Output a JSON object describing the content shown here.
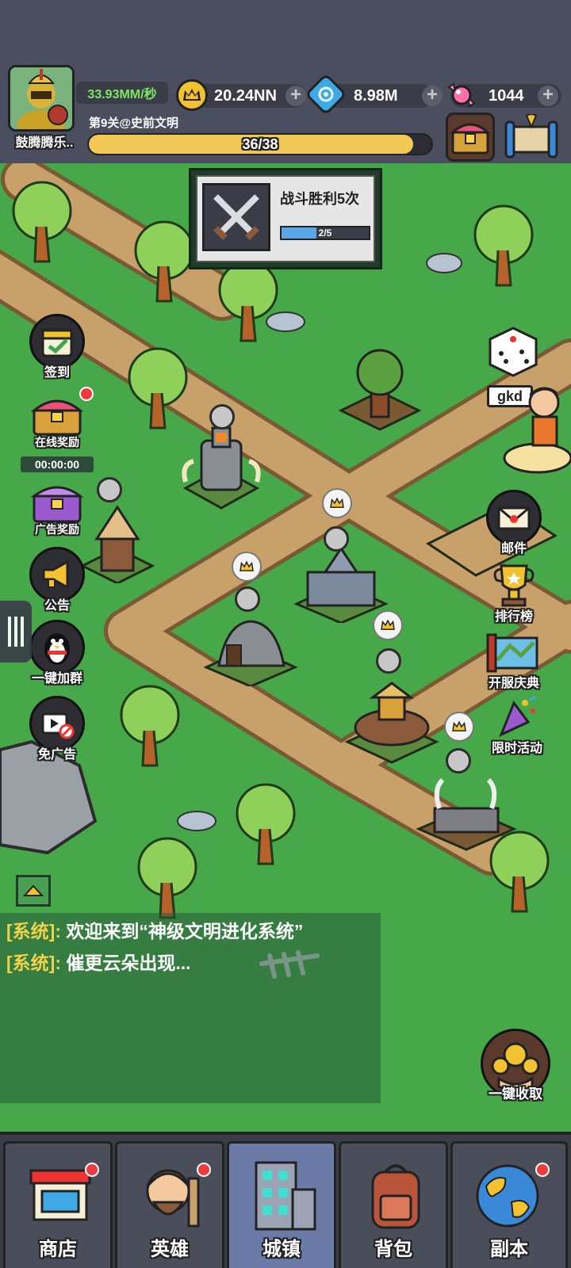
{
  "player": {
    "name": "鼓腾腾乐..",
    "rate": "33.93MM/秒"
  },
  "resources": {
    "crown": "20.24NN",
    "gem": "8.98M",
    "candy": "1044"
  },
  "level": {
    "text": "第9关@史前文明",
    "progress_label": "36/38",
    "progress_fraction": 0.947
  },
  "quest": {
    "title": "战斗胜利5次",
    "progress_label": "2/5",
    "progress_fraction": 0.4
  },
  "left_buttons": {
    "checkin": "签到",
    "online_reward": "在线奖励",
    "timer": "00:00:00",
    "ad_reward": "广告奖励",
    "notice": "公告",
    "join_group": "一键加群",
    "no_ads": "免广告"
  },
  "right_buttons": {
    "gkd": "gkd",
    "mail": "邮件",
    "ranking": "排行榜",
    "server_celebration": "开服庆典",
    "limited_event": "限时活动",
    "collect_all": "一键收取"
  },
  "chat": {
    "line1_tag": "[系统]:",
    "line1_msg": " 欢迎来到“神级文明进化系统”",
    "line2_tag": "[系统]:",
    "line2_msg": " 催更云朵出现..."
  },
  "bottom_nav": {
    "shop": "商店",
    "hero": "英雄",
    "town": "城镇",
    "bag": "背包",
    "dungeon": "副本"
  },
  "colors": {
    "grass": "#47a84a",
    "path": "#c8a06a",
    "hud_bg": "#4b4e5e",
    "accent_yellow": "#f2c957",
    "rate_green": "#7ee85f",
    "chat_tag": "#f1d34a"
  }
}
